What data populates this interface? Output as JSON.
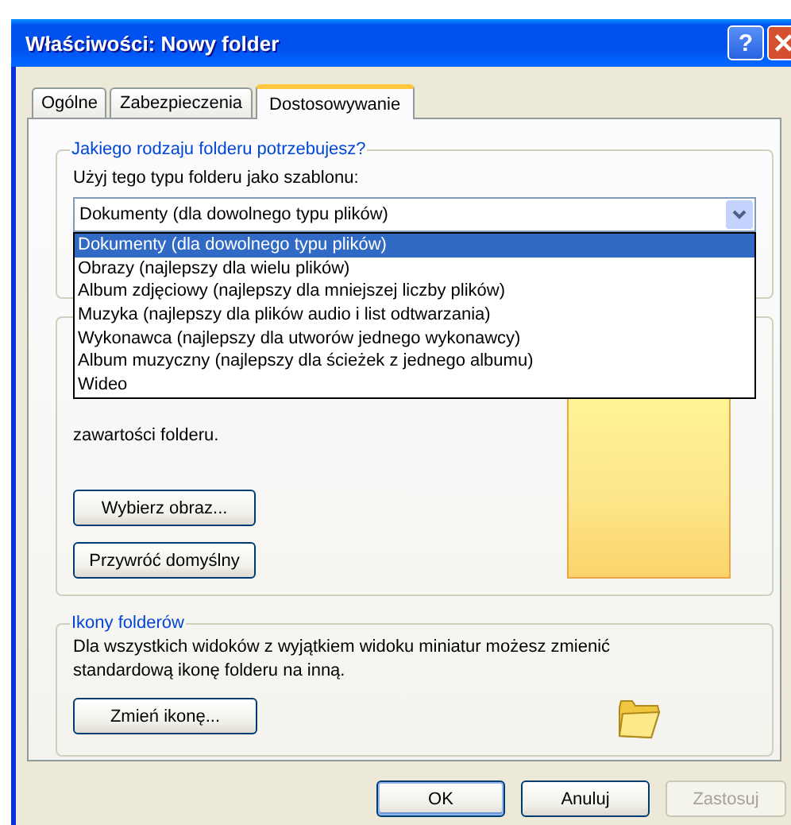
{
  "window": {
    "title": "Właściwości: Nowy folder",
    "help_button": "?"
  },
  "tabs": [
    {
      "label": "Ogólne",
      "selected": false
    },
    {
      "label": "Zabezpieczenia",
      "selected": false
    },
    {
      "label": "Dostosowywanie",
      "selected": true
    }
  ],
  "template_group": {
    "legend": "Jakiego rodzaju folderu potrzebujesz?",
    "label": "Użyj tego typu folderu jako szablonu:",
    "combo": {
      "value": "Dokumenty (dla dowolnego typu plików)",
      "expanded": true,
      "options": [
        {
          "label": "Dokumenty (dla dowolnego typu plików)",
          "selected": true
        },
        {
          "label": "Obrazy (najlepszy dla wielu plików)",
          "selected": false
        },
        {
          "label": "Album zdjęciowy (najlepszy dla mniejszej liczby plików)",
          "selected": false
        },
        {
          "label": "Muzyka (najlepszy dla plików audio i list odtwarzania)",
          "selected": false
        },
        {
          "label": "Wykonawca (najlepszy dla utworów jednego wykonawcy)",
          "selected": false
        },
        {
          "label": "Album muzyczny (najlepszy dla ścieżek z jednego albumu)",
          "selected": false
        },
        {
          "label": "Wideo",
          "selected": false
        }
      ]
    }
  },
  "picture_group": {
    "text": "zawartości folderu.",
    "buttons": [
      "Wybierz obraz...",
      "Przywróć domyślny"
    ]
  },
  "icon_group": {
    "legend": "Ikony folderów",
    "text": "Dla wszystkich widoków z wyjątkiem widoku miniatur możesz zmienić standardową ikonę folderu na inną.",
    "button": "Zmień ikonę..."
  },
  "buttons": [
    {
      "label": "OK",
      "default": true,
      "disabled": false
    },
    {
      "label": "Anuluj",
      "default": false,
      "disabled": false
    },
    {
      "label": "Zastosuj",
      "default": false,
      "disabled": true
    }
  ]
}
